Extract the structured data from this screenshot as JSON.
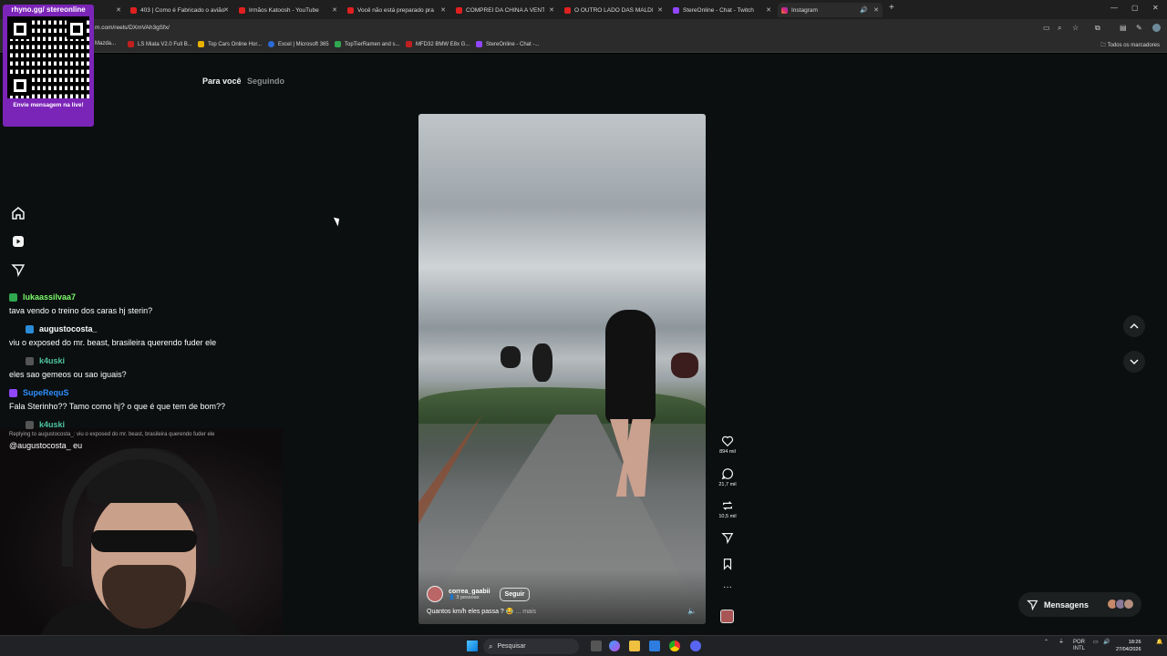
{
  "browser": {
    "tabs": [
      {
        "label": "",
        "color": "#7b25b8"
      },
      {
        "label": "403 | Como é Fabricado o avião",
        "color": "#e02020"
      },
      {
        "label": "Irmãos Katoosh - YouTube",
        "color": "#e02020"
      },
      {
        "label": "Você não está preparado pra i...",
        "color": "#e02020"
      },
      {
        "label": "COMPREI DA CHINA A VENTOI...",
        "color": "#e02020"
      },
      {
        "label": "O OUTRO LADO DAS MALDIV...",
        "color": "#e02020"
      },
      {
        "label": "StereOnline - Chat - Twitch",
        "color": "#9146ff"
      },
      {
        "label": "Instagram",
        "color": "#d62976"
      }
    ],
    "url": "m.com/reels/DXmVAh3gSfx/",
    "bookmarks": [
      {
        "label": "Mazda...",
        "color": "#888888"
      },
      {
        "label": "LS Miata V2.0 Full B...",
        "color": "#c02020"
      },
      {
        "label": "Top Cars Online Hor...",
        "color": "#e8b000"
      },
      {
        "label": "Excel | Microsoft 365",
        "color": "#2a6bd8"
      },
      {
        "label": "TopTierRamen and s...",
        "color": "#2fa84f"
      },
      {
        "label": "MFD32 BMW E8x G...",
        "color": "#c02020"
      },
      {
        "label": "StereOnline - Chat -...",
        "color": "#9146ff"
      }
    ],
    "all_bookmarks": "Todos os marcadores"
  },
  "instagram": {
    "feed_tabs": {
      "active": "Para você",
      "inactive": "Seguindo"
    },
    "reel": {
      "author": "correa_gaabii",
      "author_sub": "3 pessoas",
      "follow": "Seguir",
      "caption": "Quantos km/h eles passa ? 😂",
      "caption_more": "... mais"
    },
    "actions": {
      "likes": "894 mil",
      "comments": "21,7 mil",
      "reposts": "10,5 mil"
    },
    "messages": "Mensagens"
  },
  "overlay": {
    "qr_title": "rhyno.gg/ stereonline",
    "qr_caption": "Envie mensagem na live!",
    "chat": [
      {
        "user": "lukaassilvaa7",
        "color": "#7cfc6a",
        "badge": "#2fa84f",
        "text": "tava vendo o treino dos caras hj sterin?"
      },
      {
        "user": "augustocosta_",
        "color": "#ffffff",
        "badge": "#2a8bd8",
        "text": "viu o exposed do mr. beast, brasileira querendo fuder ele"
      },
      {
        "user": "k4uski",
        "color": "#4fc3a1",
        "badge": "#555555",
        "text": "eles sao gemeos ou sao iguais?"
      },
      {
        "user": "SupeRequS",
        "color": "#2f8fff",
        "badge": "#9146ff",
        "text": "Fala Sterinho?? Tamo como hj? o que é que tem de bom??"
      },
      {
        "user": "k4uski",
        "color": "#4fc3a1",
        "badge": "#555555",
        "reply": "Replying to augustocosta_: viu o exposed do mr. beast, brasileira querendo fuder ele",
        "text": "@augustocosta_ eu"
      }
    ]
  },
  "taskbar": {
    "search": "Pesquisar",
    "lang": "POR",
    "layout": "INTL",
    "time": "18:26",
    "date": "27/04/2026"
  }
}
